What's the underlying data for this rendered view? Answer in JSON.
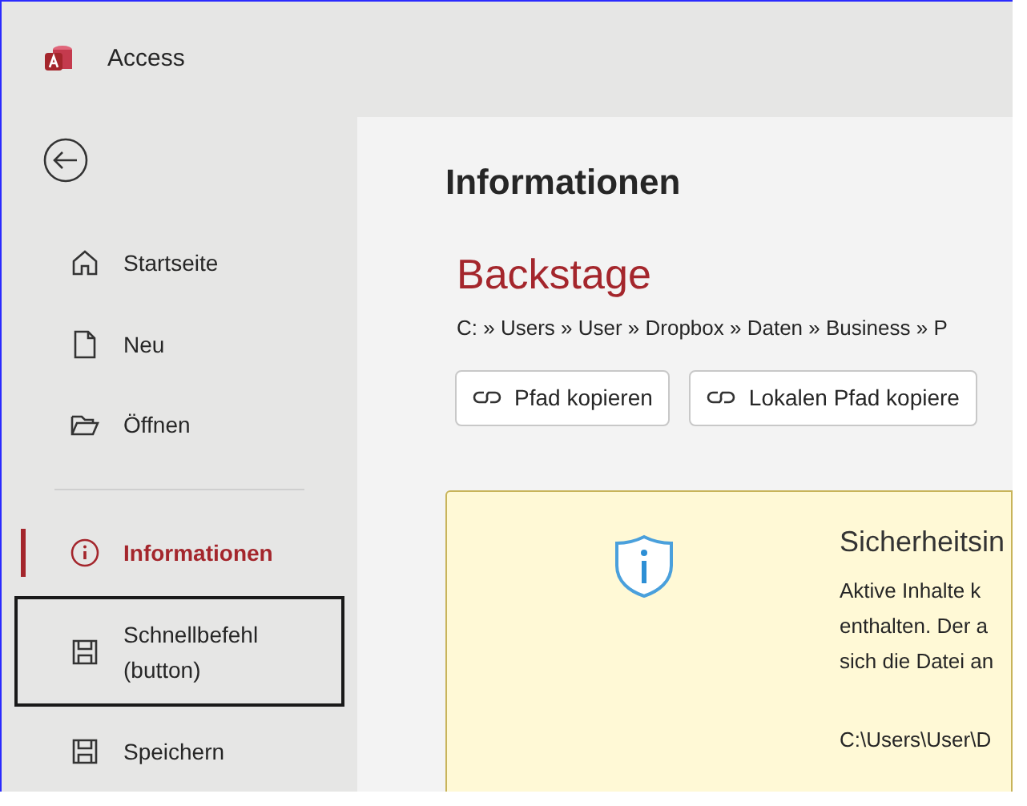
{
  "app": {
    "title": "Access"
  },
  "sidebar": {
    "items": [
      {
        "label": "Startseite",
        "kind": "home",
        "selected": false,
        "outlined": false
      },
      {
        "label": "Neu",
        "kind": "new",
        "selected": false,
        "outlined": false
      },
      {
        "label": "Öffnen",
        "kind": "open",
        "selected": false,
        "outlined": false
      },
      {
        "kind": "divider"
      },
      {
        "label": "Informationen",
        "kind": "info",
        "selected": true,
        "outlined": false
      },
      {
        "label": "Schnellbefehl (button)",
        "kind": "save",
        "selected": false,
        "outlined": true
      },
      {
        "label": "Speichern",
        "kind": "save",
        "selected": false,
        "outlined": false
      }
    ]
  },
  "content": {
    "heading": "Informationen",
    "title": "Backstage",
    "path": "C: » Users » User » Dropbox » Daten » Business » P",
    "buttons": [
      "Pfad kopieren",
      "Lokalen Pfad kopiere"
    ],
    "security": {
      "title": "Sicherheitsin",
      "lines": [
        "Aktive Inhalte k",
        "enthalten. Der a",
        "sich die Datei an"
      ],
      "file_path": "C:\\Users\\User\\D"
    }
  }
}
